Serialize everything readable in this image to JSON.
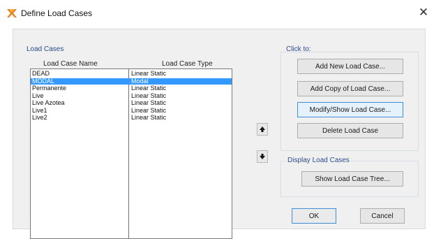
{
  "window": {
    "title": "Define Load Cases",
    "close_symbol": "✕"
  },
  "load_cases_group": {
    "title": "Load Cases",
    "column_name_header": "Load Case Name",
    "column_type_header": "Load Case Type",
    "rows": [
      {
        "name": "DEAD",
        "type": "Linear Static",
        "selected": false
      },
      {
        "name": "MODAL",
        "type": "Modal",
        "selected": true
      },
      {
        "name": "Permanente",
        "type": "Linear Static",
        "selected": false
      },
      {
        "name": "Live",
        "type": "Linear Static",
        "selected": false
      },
      {
        "name": "Live Azotea",
        "type": "Linear Static",
        "selected": false
      },
      {
        "name": "Live1",
        "type": "Linear Static",
        "selected": false
      },
      {
        "name": "Live2",
        "type": "Linear Static",
        "selected": false
      }
    ],
    "move_up_icon": "arrow-up-icon",
    "move_down_icon": "arrow-down-icon"
  },
  "click_to_group": {
    "title": "Click to:",
    "add_new_label": "Add New Load Case...",
    "add_copy_label": "Add Copy of Load Case...",
    "modify_show_label": "Modify/Show Load Case...",
    "delete_label": "Delete Load Case"
  },
  "display_group": {
    "title": "Display Load Cases",
    "show_tree_label": "Show Load Case Tree..."
  },
  "footer": {
    "ok_label": "OK",
    "cancel_label": "Cancel"
  },
  "colors": {
    "selection": "#3399ff",
    "focus_border": "#3f8fd6",
    "group_title": "#2a4a8a"
  }
}
